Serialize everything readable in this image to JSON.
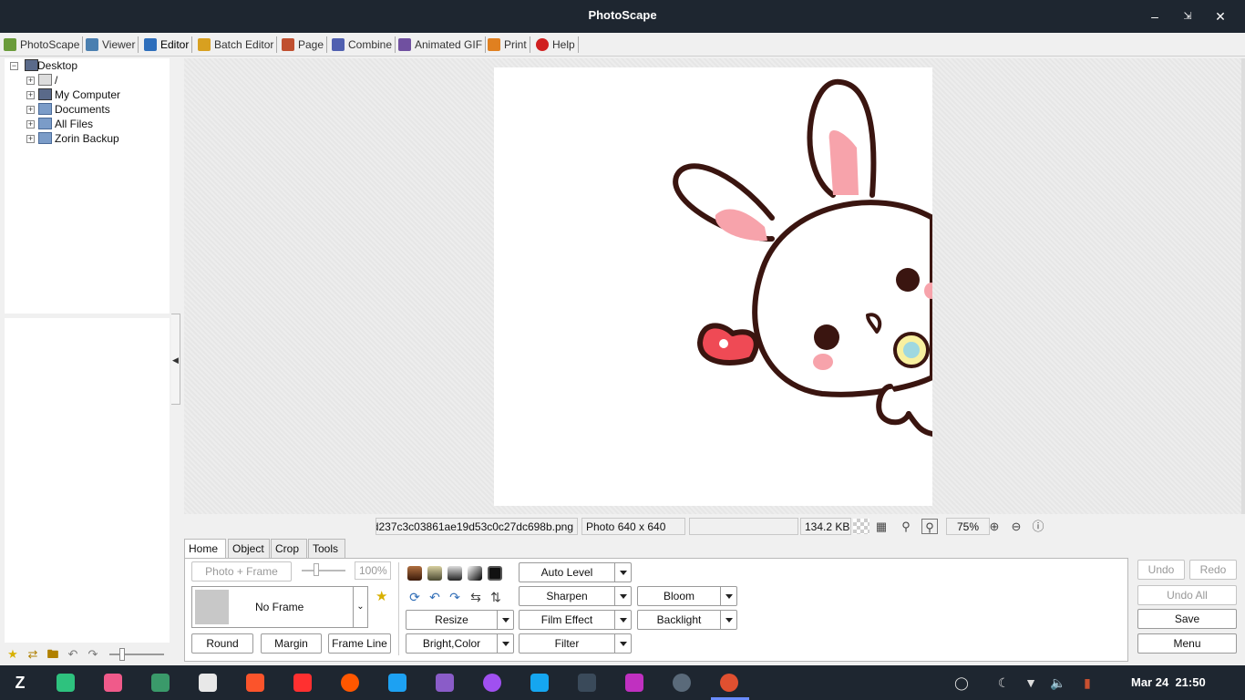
{
  "window": {
    "title": "PhotoScape"
  },
  "tabs": [
    {
      "label": "PhotoScape",
      "color": "#6a9b3a"
    },
    {
      "label": "Viewer",
      "color": "#4a7fb0"
    },
    {
      "label": "Editor",
      "color": "#2e6ebb"
    },
    {
      "label": "Batch Editor",
      "color": "#d8a020"
    },
    {
      "label": "Page",
      "color": "#c05030"
    },
    {
      "label": "Combine",
      "color": "#5060b0"
    },
    {
      "label": "Animated GIF",
      "color": "#7050a0"
    },
    {
      "label": "Print",
      "color": "#e08020"
    },
    {
      "label": "Help",
      "color": "#d02020"
    }
  ],
  "tree": {
    "root": "Desktop",
    "items": [
      "/",
      "My Computer",
      "Documents",
      "All Files",
      "Zorin Backup"
    ]
  },
  "status": {
    "filename": "d237c3c03861ae19d53c0c27dc698b.png",
    "dimensions": "Photo 640 x 640",
    "filesize": "134.2 KB",
    "zoom": "75%"
  },
  "panel_tabs": [
    "Home",
    "Object",
    "Crop",
    "Tools"
  ],
  "home": {
    "photo_frame": "Photo + Frame",
    "frame_percent": "100%",
    "frame_name": "No Frame",
    "round": "Round",
    "margin": "Margin",
    "frame_line": "Frame Line",
    "auto_level": "Auto Level",
    "sharpen": "Sharpen",
    "bloom": "Bloom",
    "resize": "Resize",
    "film_effect": "Film Effect",
    "backlight": "Backlight",
    "bright_color": "Bright,Color",
    "filter": "Filter"
  },
  "actions": {
    "undo": "Undo",
    "redo": "Redo",
    "undo_all": "Undo All",
    "save": "Save",
    "menu": "Menu"
  },
  "taskbar": {
    "date": "Mar 24",
    "time": "21:50",
    "apps": [
      {
        "name": "zorin-menu-icon",
        "color": "#1e2630"
      },
      {
        "name": "tasks-icon",
        "color": "#2ec27e"
      },
      {
        "name": "tiktok-icon",
        "color": "#f05a8a"
      },
      {
        "name": "files-icon",
        "color": "#3a9a6a"
      },
      {
        "name": "store-icon",
        "color": "#e8e8e8"
      },
      {
        "name": "brave-icon",
        "color": "#fb542b"
      },
      {
        "name": "youtube-icon",
        "color": "#ff3030"
      },
      {
        "name": "reddit-icon",
        "color": "#ff5700"
      },
      {
        "name": "twitter-icon",
        "color": "#1da1f2"
      },
      {
        "name": "tiktok-web-icon",
        "color": "#8a5cc8"
      },
      {
        "name": "messenger-icon",
        "color": "#a050f0"
      },
      {
        "name": "zorin-connect-icon",
        "color": "#15a6f0"
      },
      {
        "name": "terminal-icon",
        "color": "#3a4a5a"
      },
      {
        "name": "send-icon",
        "color": "#c030c0"
      },
      {
        "name": "speedometer-icon",
        "color": "#5a6a7a"
      },
      {
        "name": "photoscape-icon",
        "color": "#e05030"
      }
    ]
  }
}
